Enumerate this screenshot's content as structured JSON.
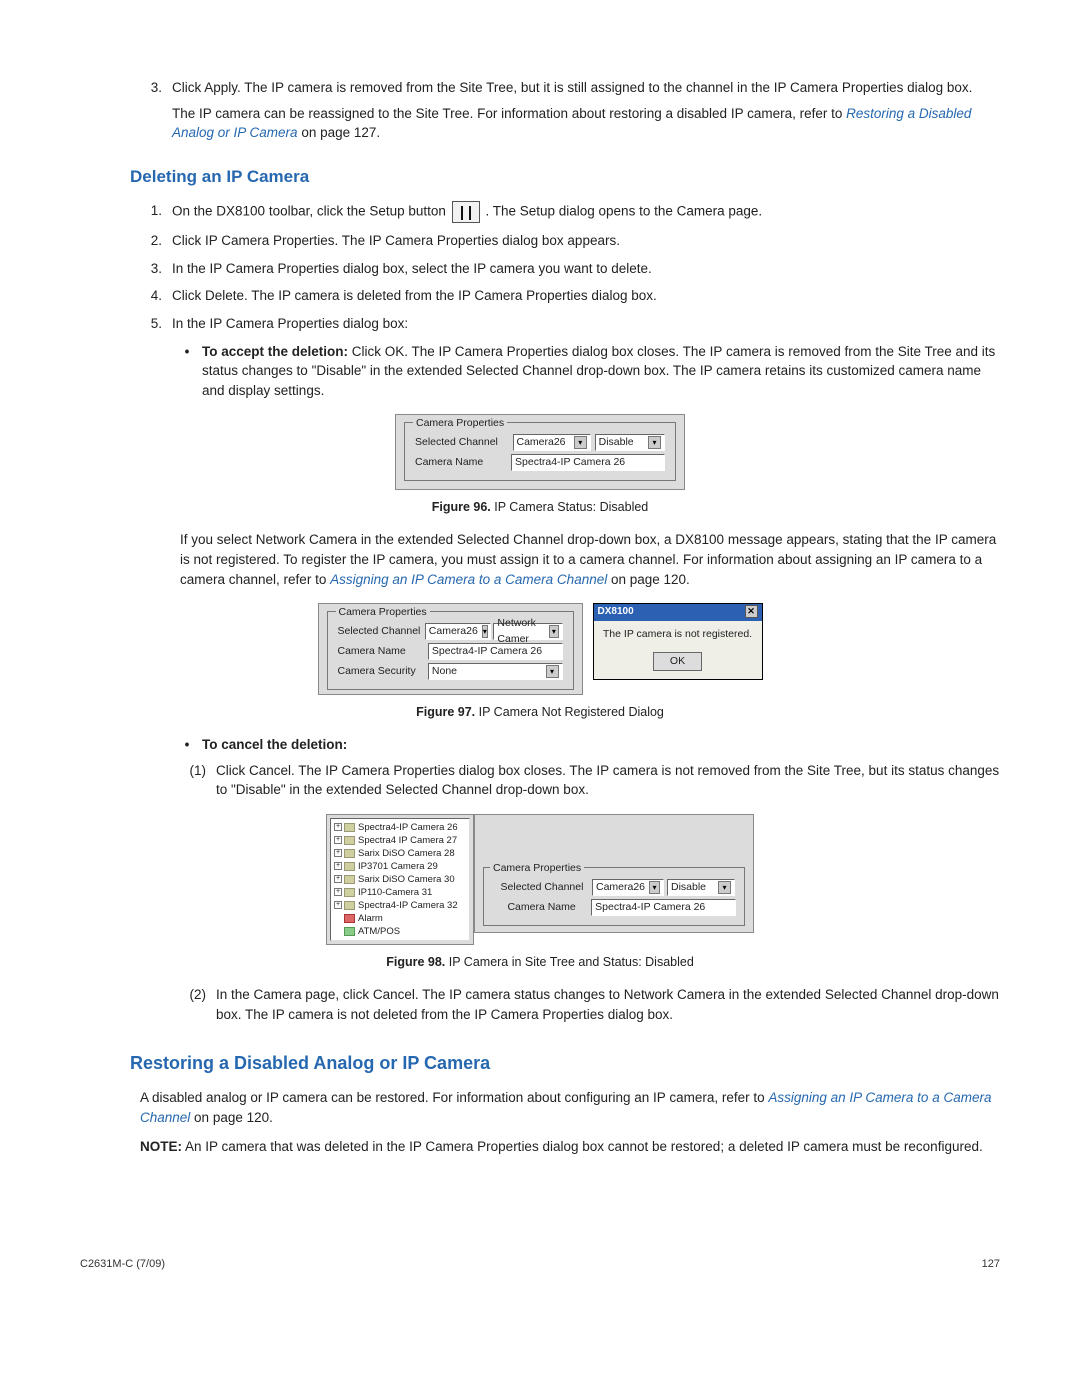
{
  "step3": {
    "main": "Click Apply. The IP camera is removed from the Site Tree, but it is still assigned to the channel in the IP Camera Properties dialog box.",
    "sub1a": "The IP camera can be reassigned to the Site Tree. For information about restoring a disabled IP camera, refer to ",
    "link": "Restoring a Disabled Analog or IP Camera",
    "sub1b": " on page 127."
  },
  "h_delete": "Deleting an IP Camera",
  "del": {
    "s1a": "On the DX8100 toolbar, click the Setup button ",
    "s1b": ". The Setup dialog opens to the Camera page.",
    "s2": "Click IP Camera Properties. The IP Camera Properties dialog box appears.",
    "s3": "In the IP Camera Properties dialog box, select the IP camera you want to delete.",
    "s4": "Click Delete. The IP camera is deleted from the IP Camera Properties dialog box.",
    "s5": "In the IP Camera Properties dialog box:",
    "b1_lead": "To accept the deletion:",
    "b1_body": " Click OK. The IP Camera Properties dialog box closes. The IP camera is removed from the Site Tree and its status changes to \"Disable\" in the extended Selected Channel drop-down box. The IP camera retains its customized camera name and display settings."
  },
  "fig96": {
    "legend": "Camera Properties",
    "lbl_sel": "Selected Channel",
    "lbl_name": "Camera Name",
    "sel_val": "Camera26",
    "status_val": "Disable",
    "name_val": "Spectra4-IP Camera 26",
    "caption_b": "Figure 96.",
    "caption_t": "  IP Camera Status: Disabled"
  },
  "para_after96a": "If you select Network Camera in the extended Selected Channel drop-down box, a DX8100 message appears, stating that the IP camera is not registered. To register the IP camera, you must assign it to a camera channel. For information about assigning an IP camera to a camera channel, refer to ",
  "para_after96_link": "Assigning an IP Camera to a Camera Channel",
  "para_after96b": " on page 120.",
  "fig97": {
    "legend": "Camera Properties",
    "lbl_sel": "Selected Channel",
    "lbl_name": "Camera Name",
    "lbl_sec": "Camera Security",
    "sel_val": "Camera26",
    "status_val": "Network Camer",
    "name_val": "Spectra4-IP Camera 26",
    "sec_val": "None",
    "msg_title": "DX8100",
    "msg_text": "The IP camera is not registered.",
    "msg_ok": "OK",
    "caption_b": "Figure 97.",
    "caption_t": "  IP Camera Not Registered Dialog"
  },
  "cancel": {
    "lead": "To cancel the deletion:",
    "s1": "Click Cancel. The IP Camera Properties dialog box closes. The IP camera is not removed from the Site Tree, but its status changes to \"Disable\" in the extended Selected Channel drop-down box."
  },
  "fig98": {
    "tree": [
      "Spectra4-IP Camera 26",
      "Spectra4 IP Camera 27",
      "Sarix DiSO Camera 28",
      "IP3701 Camera 29",
      "Sarix DiSO Camera 30",
      "IP110-Camera 31",
      "Spectra4-IP Camera 32"
    ],
    "alarm": "Alarm",
    "atm": "ATM/POS",
    "legend": "Camera Properties",
    "lbl_sel": "Selected Channel",
    "lbl_name": "Camera Name",
    "sel_val": "Camera26",
    "status_val": "Disable",
    "name_val": "Spectra4-IP Camera 26",
    "caption_b": "Figure 98.",
    "caption_t": "  IP Camera in Site Tree and Status: Disabled"
  },
  "cancel_s2": "In the Camera page, click Cancel. The IP camera status changes to Network Camera in the extended Selected Channel drop-down box. The IP camera is not deleted from the IP Camera Properties dialog box.",
  "h_restore": "Restoring a Disabled Analog or IP Camera",
  "restore_p1a": "A disabled analog or IP camera can be restored. For information about configuring an IP camera, refer to ",
  "restore_link": "Assigning an IP Camera to a Camera Channel",
  "restore_p1b": " on page 120.",
  "restore_note_b": "NOTE:",
  "restore_note": " An IP camera that was deleted in the IP Camera Properties dialog box cannot be restored; a deleted IP camera must be reconfigured.",
  "footer_l": "C2631M-C (7/09)",
  "footer_r": "127"
}
